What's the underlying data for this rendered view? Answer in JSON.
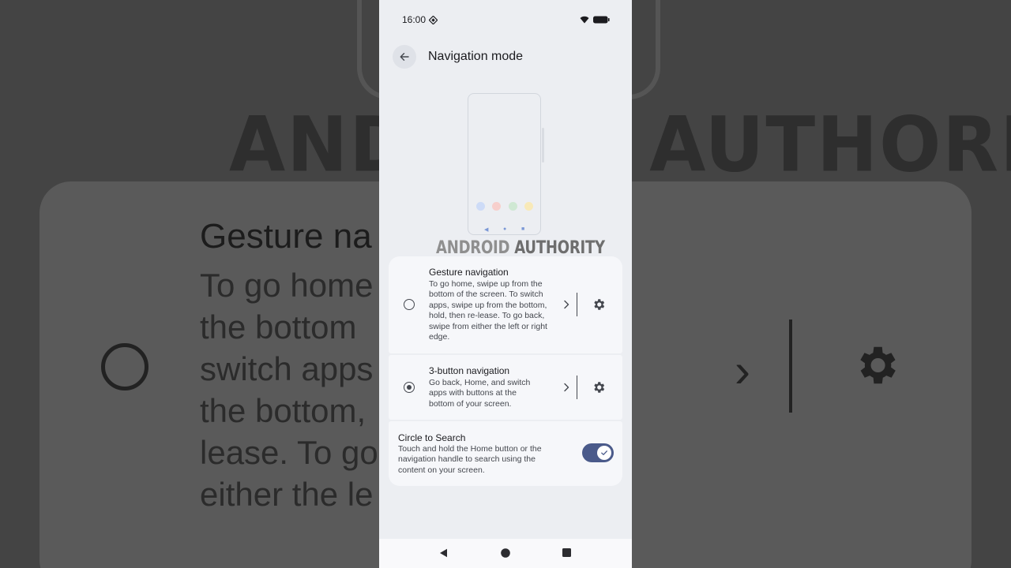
{
  "background": {
    "brand_text": "ANDROID AUTHORITY",
    "title": "Gesture na",
    "lines": "To go home\nthe bottom\nswitch apps\nthe bottom,\nlease. To go\neither the le"
  },
  "status_bar": {
    "time": "16:00"
  },
  "header": {
    "title": "Navigation mode"
  },
  "watermark": {
    "part1": "ANDROID",
    "part2": "AUTHORITY"
  },
  "illustration": {
    "dot_colors": [
      "#cddbf7",
      "#f7cfcc",
      "#cfe8d3",
      "#f8e9b8"
    ]
  },
  "options": [
    {
      "title": "Gesture navigation",
      "description": "To go home, swipe up from the bottom of the screen. To switch apps, swipe up from the bottom, hold, then re-lease. To go back, swipe from either the left or right edge.",
      "selected": false
    },
    {
      "title": "3-button navigation",
      "description": "Go back, Home, and switch apps with buttons at the bottom of your screen.",
      "selected": true
    }
  ],
  "circle_to_search": {
    "title": "Circle to Search",
    "description": "Touch and hold the Home button or the navigation handle to search using the content on your screen.",
    "enabled": true
  },
  "colors": {
    "accent": "#4a5a8a",
    "surface": "#f6f7fa",
    "background": "#eceef2"
  }
}
